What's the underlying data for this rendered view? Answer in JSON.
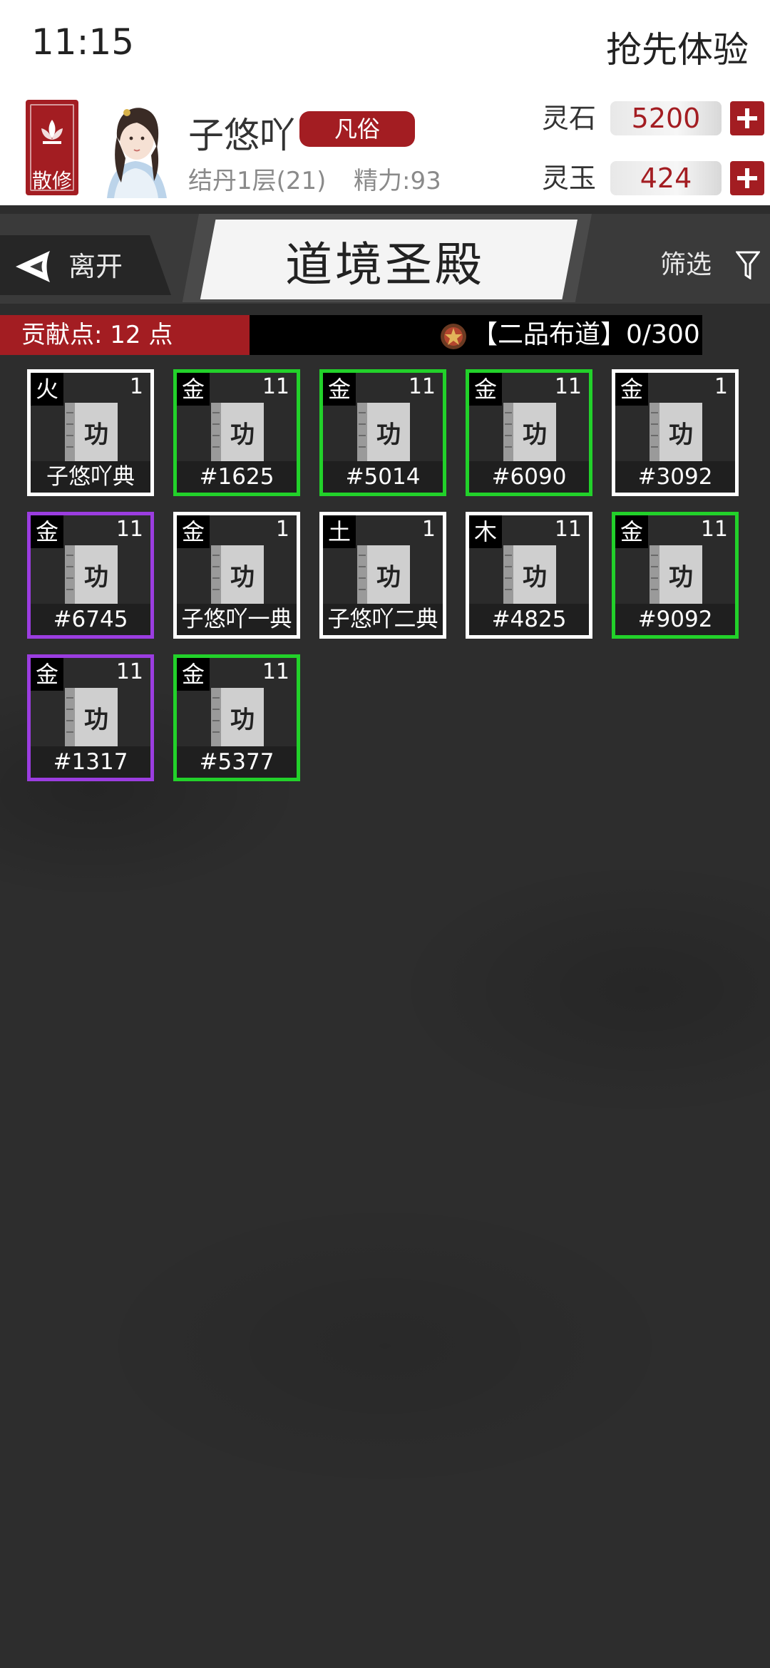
{
  "status_bar": {
    "time": "11:15",
    "right_text": "抢先体验"
  },
  "player": {
    "sect_label": "散修",
    "name": "子悠吖",
    "rank": "凡俗",
    "level": "结丹1层(21)",
    "energy": "精力:93"
  },
  "currency": [
    {
      "label": "灵石",
      "value": "5200"
    },
    {
      "label": "灵玉",
      "value": "424"
    }
  ],
  "nav": {
    "back_label": "离开",
    "title": "道境圣殿",
    "filter_label": "筛选"
  },
  "contribution": {
    "points": "贡献点: 12 点",
    "rank_progress": "【二品布道】0/300"
  },
  "colors": {
    "accent_red": "#a31d22",
    "quality_white": "#ffffff",
    "quality_green": "#22d12a",
    "quality_purple": "#9b3de0"
  },
  "book_glyph": "功",
  "techniques": [
    {
      "element": "火",
      "level": "1",
      "name": "子悠吖典",
      "quality": "white"
    },
    {
      "element": "金",
      "level": "11",
      "name": "#1625",
      "quality": "green"
    },
    {
      "element": "金",
      "level": "11",
      "name": "#5014",
      "quality": "green"
    },
    {
      "element": "金",
      "level": "11",
      "name": "#6090",
      "quality": "green"
    },
    {
      "element": "金",
      "level": "1",
      "name": "#3092",
      "quality": "white"
    },
    {
      "element": "金",
      "level": "11",
      "name": "#6745",
      "quality": "purple"
    },
    {
      "element": "金",
      "level": "1",
      "name": "子悠吖一典",
      "quality": "white"
    },
    {
      "element": "土",
      "level": "1",
      "name": "子悠吖二典",
      "quality": "white"
    },
    {
      "element": "木",
      "level": "11",
      "name": "#4825",
      "quality": "white"
    },
    {
      "element": "金",
      "level": "11",
      "name": "#9092",
      "quality": "green"
    },
    {
      "element": "金",
      "level": "11",
      "name": "#1317",
      "quality": "purple"
    },
    {
      "element": "金",
      "level": "11",
      "name": "#5377",
      "quality": "green"
    }
  ]
}
